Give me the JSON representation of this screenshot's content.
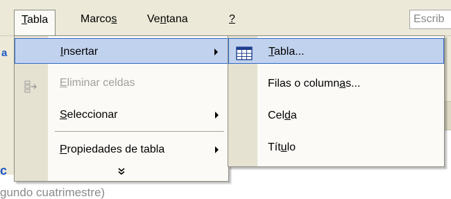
{
  "menubar": {
    "items": [
      {
        "key": "tabla",
        "label": "Tabla",
        "accel_index": 0
      },
      {
        "key": "marcos",
        "label": "Marcos",
        "accel_index": 5
      },
      {
        "key": "ventana",
        "label": "Ventana",
        "accel_index": 2
      },
      {
        "key": "help",
        "label": "?",
        "accel_index": 0
      }
    ],
    "search_placeholder": "Escrib"
  },
  "tabla_menu": {
    "items": [
      {
        "key": "insertar",
        "label": "Insertar",
        "accel_index": 0,
        "submenu": true,
        "highlighted": true,
        "disabled": false
      },
      {
        "key": "eliminar_celdas",
        "label": "Eliminar celdas",
        "accel_index": 0,
        "submenu": false,
        "highlighted": false,
        "disabled": true,
        "icon": "delete-cells-icon"
      },
      {
        "key": "seleccionar",
        "label": "Seleccionar",
        "accel_index": 0,
        "submenu": true,
        "highlighted": false,
        "disabled": false
      },
      {
        "key": "propiedades",
        "label": "Propiedades de tabla",
        "accel_index": 0,
        "submenu": true,
        "highlighted": false,
        "disabled": false
      }
    ],
    "expand_icon": "double-chevron-down-icon"
  },
  "insertar_submenu": {
    "items": [
      {
        "key": "tabla",
        "label": "Tabla...",
        "accel_index": 0,
        "highlighted": true,
        "icon": "insert-table-icon"
      },
      {
        "key": "filas_columnas",
        "label": "Filas o columnas...",
        "accel_index": 14,
        "highlighted": false
      },
      {
        "key": "celda",
        "label": "Celda",
        "accel_index": 3,
        "highlighted": false
      },
      {
        "key": "titulo",
        "label": "Título",
        "accel_index": 3,
        "highlighted": false
      }
    ]
  },
  "background": {
    "doc_fragment": "gundo cuatrimestre)",
    "left_fragments": [
      "a",
      "c"
    ]
  },
  "colors": {
    "menubar_bg": "#ece9d8",
    "menu_bg": "#fbfaf6",
    "icon_column": "#e6e2d1",
    "highlight_fill": "#c1d2ee",
    "highlight_border": "#316ac5",
    "disabled_text": "#a0a0a0"
  }
}
